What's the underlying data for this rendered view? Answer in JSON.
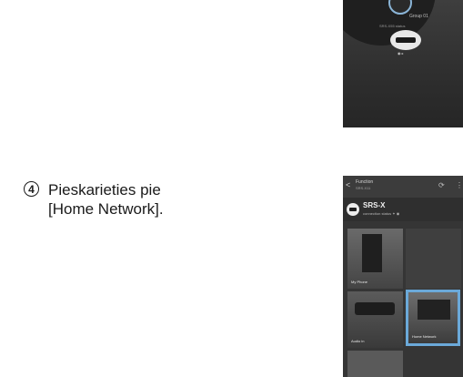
{
  "step": {
    "number": "4",
    "text_line1": "Pieskarieties pie",
    "text_line2": "[Home Network]."
  },
  "screen1": {
    "group": "Group 01",
    "sub": "SRS-X55 status",
    "label": "◉ ▸"
  },
  "screen2": {
    "back": "<",
    "title": "Function",
    "subtitle": "SRS-X11",
    "device_name": "SRS-X",
    "device_status": "connection status  ✦ ◉",
    "tiles": [
      {
        "label": "My Phone"
      },
      {
        "label": ""
      },
      {
        "label": "Audio in"
      },
      {
        "label": "Home Network"
      }
    ],
    "accent_color": "#6ba9d9"
  }
}
